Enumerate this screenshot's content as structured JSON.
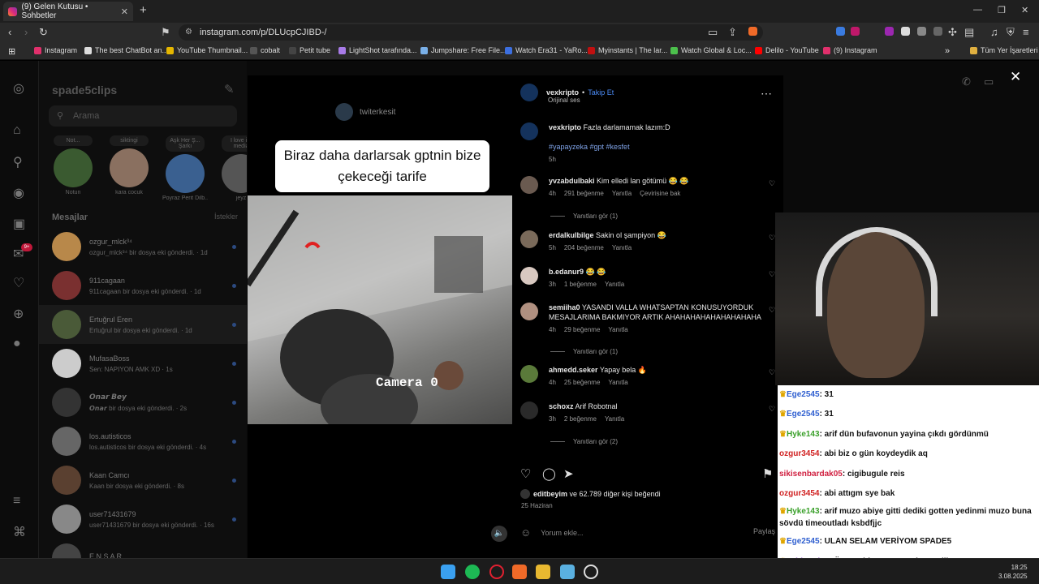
{
  "browser": {
    "tab_title": "(9) Gelen Kutusu • Sohbetler",
    "url": "instagram.com/p/DLUcpCJIBD-/",
    "bookmarks": [
      {
        "label": "Instagram",
        "color": "#e1306c"
      },
      {
        "label": "The best ChatBot an...",
        "color": "#dddddd"
      },
      {
        "label": "YouTube Thumbnail...",
        "color": "#e5b600"
      },
      {
        "label": "cobalt",
        "color": "#555555"
      },
      {
        "label": "Petit tube",
        "color": "#444444"
      },
      {
        "label": "LightShot tarafında...",
        "color": "#a87be8"
      },
      {
        "label": "Jumpshare: Free File...",
        "color": "#7ab0e8"
      },
      {
        "label": "Watch Era31 - YaRo...",
        "color": "#3c6fe0"
      },
      {
        "label": "Myinstants | The lar...",
        "color": "#c01010"
      },
      {
        "label": "Watch Global & Loc...",
        "color": "#4cc04c"
      },
      {
        "label": "Delilo - YouTube",
        "color": "#ff0000"
      },
      {
        "label": "(9) Instagram",
        "color": "#e1306c"
      }
    ],
    "all_bookmarks": "Tüm Yer İşaretleri"
  },
  "dm": {
    "username": "spade5clips",
    "search_placeholder": "Arama",
    "section_title": "Mesajlar",
    "requests": "İstekler",
    "stories": [
      {
        "note": "Not...",
        "name": "Notun"
      },
      {
        "note": "siktingi",
        "name": "kara cocuk"
      },
      {
        "note": "Aşk Her Ş... Şarkı",
        "name": "Poyraz Perit Dilb..."
      },
      {
        "note": "I love i... media",
        "name": "jeyz"
      }
    ],
    "conversations": [
      {
        "name": "ozgur_mlck³⁴",
        "snippet": "ozgur_mlck³⁴ bir dosya eki gönderdi. · 1d",
        "color": "#b8884a"
      },
      {
        "name": "911cagaan",
        "snippet": "911cagaan bir dosya eki gönderdi. · 1d",
        "color": "#7a3030"
      },
      {
        "name": "Ertuğrul Eren",
        "snippet": "Ertuğrul bir dosya eki gönderdi. · 1d",
        "color": "#4a5a38"
      },
      {
        "name": "MufasaBoss",
        "snippet": "Sen: NAPIYON AMK XD · 1s",
        "color": "#cccccc"
      },
      {
        "name": "𝙊𝙣𝙖𝙧 𝘽𝙚𝙮",
        "snippet": "𝙊𝙣𝙖𝙧 bir dosya eki gönderdi. · 2s",
        "color": "#333333"
      },
      {
        "name": "los.autisticos",
        "snippet": "los.autisticos bir dosya eki gönderdi. · 4s",
        "color": "#666666"
      },
      {
        "name": "Kaan Camcı",
        "snippet": "Kaan bir dosya eki gönderdi. · 8s",
        "color": "#5a4030"
      },
      {
        "name": "user71431679",
        "snippet": "user71431679 bir dosya eki gönderdi. · 16s",
        "color": "#888888"
      },
      {
        "name": "E N S A R",
        "snippet": "",
        "color": "#444444"
      }
    ]
  },
  "video": {
    "watermark": "twiterkesit",
    "caption_line1": "Biraz daha darlarsak gptnin bize",
    "caption_line2": "çekeceği tarife",
    "camera_label": "Camera 0"
  },
  "post": {
    "author": "vexkripto",
    "follow": "Takip Et",
    "audio": "Orijinal ses",
    "caption_user": "vexkripto",
    "caption_text": "Fazla darlamamak lazım:D",
    "hashtags": "#yapayzeka #gpt #kesfet",
    "caption_time": "5h",
    "comments": [
      {
        "user": "yvzabdulbaki",
        "text": "Kim elledi lan götümü 😂 😂",
        "time": "4h",
        "likes": "291 beğenme",
        "reply": "Yanıtla",
        "extra": "Çevirisine bak",
        "replies": "Yanıtları gör (1)",
        "color": "#6a5a50"
      },
      {
        "user": "erdalkulbilge",
        "text": "Sakin ol şampiyon 😂",
        "time": "5h",
        "likes": "204 beğenme",
        "reply": "Yanıtla",
        "extra": "",
        "replies": "",
        "color": "#7a6a5a"
      },
      {
        "user": "b.edanur9",
        "text": "😂 😂",
        "time": "3h",
        "likes": "1 beğenme",
        "reply": "Yanıtla",
        "extra": "",
        "replies": "",
        "color": "#d8c8c0"
      },
      {
        "user": "semiiha0",
        "text": "YASANDI VALLA WHATSAPTAN KONUSUYORDUK MESAJLARIMA BAKMIYOR ARTIK AHAHAHAHAHAHAHAHAHA",
        "time": "4h",
        "likes": "29 beğenme",
        "reply": "Yanıtla",
        "extra": "",
        "replies": "Yanıtları gör (1)",
        "color": "#b09080"
      },
      {
        "user": "ahmedd.seker",
        "text": "Yapay bela 🔥",
        "time": "4h",
        "likes": "25 beğenme",
        "reply": "Yanıtla",
        "extra": "",
        "replies": "",
        "color": "#5a7a3a"
      },
      {
        "user": "schoxz",
        "text": "Arif Robotnal",
        "time": "3h",
        "likes": "2 beğenme",
        "reply": "Yanıtla",
        "extra": "",
        "replies": "Yanıtları gör (2)",
        "color": "#2a2a2a"
      }
    ],
    "liked_by_user": "editbeyim",
    "liked_by_rest": " ve 62.789 diğer kişi beğendi",
    "date": "25 Haziran",
    "comment_placeholder": "Yorum ekle...",
    "share": "Paylaş"
  },
  "chat": [
    {
      "user": "Ege2545",
      "msg": "31",
      "crown": true,
      "color": "#2f5fd0"
    },
    {
      "user": "Ege2545",
      "msg": "31",
      "crown": true,
      "color": "#2f5fd0"
    },
    {
      "user": "Hyke143",
      "msg": "arif dün bufavonun yayina çıkdı gördünmü",
      "crown": true,
      "color": "#3aa02a"
    },
    {
      "user": "ozgur3454",
      "msg": "abi biz o gün koydeydik aq",
      "crown": false,
      "color": "#d02020"
    },
    {
      "user": "sikisenbardak05",
      "msg": "cigibugule reis",
      "crown": false,
      "color": "#d02040"
    },
    {
      "user": "ozgur3454",
      "msg": "abi attıgm sye bak",
      "crown": false,
      "color": "#d02020"
    },
    {
      "user": "Hyke143",
      "msg": "arif muzo abiye gitti dediki gotten yedinmi muzo buna sövdü timeoutladı ksbdfjjc",
      "crown": true,
      "color": "#3aa02a"
    },
    {
      "user": "Ege2545",
      "msg": "ULAN SELAM VERİYOM SPADE5",
      "crown": true,
      "color": "#2f5fd0"
    },
    {
      "user": "cabbareiss",
      "msg": "Ömer Abi Suareze Selam Yollicanmı",
      "crown": true,
      "color": "#8a3ad0"
    }
  ],
  "taskbar": {
    "time": "18:25",
    "date": "3.08.2025"
  }
}
